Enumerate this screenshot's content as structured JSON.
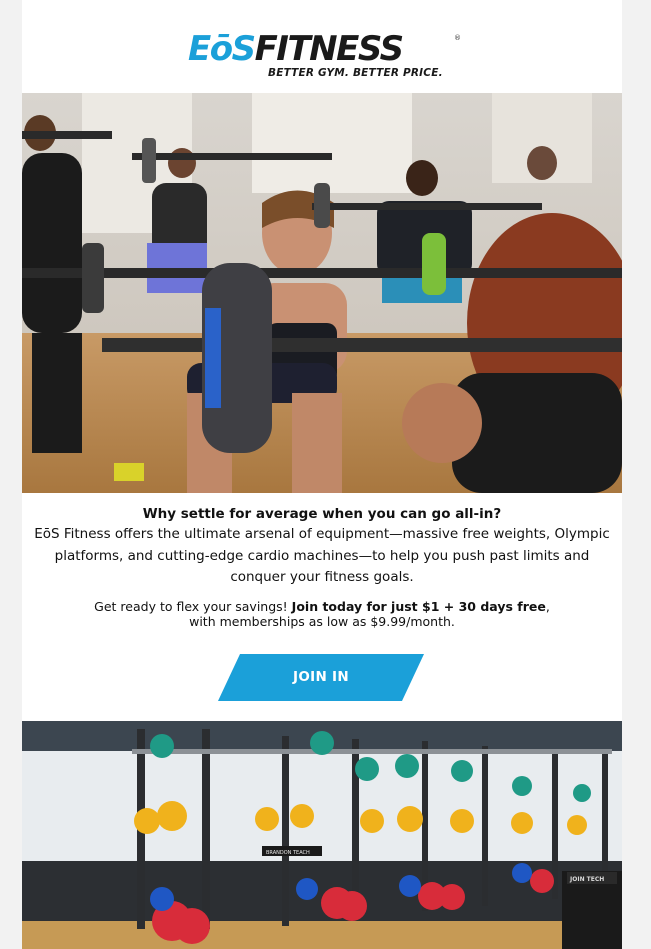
{
  "brand": {
    "logo_eos": "EōS",
    "logo_fitness": "FITNESS",
    "registered": "®",
    "tagline": "BETTER GYM. BETTER PRICE."
  },
  "colors": {
    "brand_blue": "#1ba0d9",
    "dark": "#1a1a1a",
    "page_bg": "#f2f2f2"
  },
  "hero_image": {
    "icon": "group-barbell-class-photo"
  },
  "content": {
    "headline": "Why settle for average when you can go all-in?",
    "body": "EōS Fitness offers the ultimate arsenal of equipment—massive free weights, Olympic platforms, and cutting-edge cardio machines—to help you push past limits and conquer your fitness goals.",
    "offer_intro": "Get ready to flex your savings! ",
    "offer_bold": "Join today for just $1 + 30 days free",
    "offer_outro": ", with memberships as low as $9.99/month."
  },
  "cta": {
    "label": "JOIN IN"
  },
  "gym_image": {
    "icon": "squat-racks-gym-floor-photo",
    "rack_label": "BRANDON TEACH",
    "sign_label": "JOIN TECH"
  }
}
